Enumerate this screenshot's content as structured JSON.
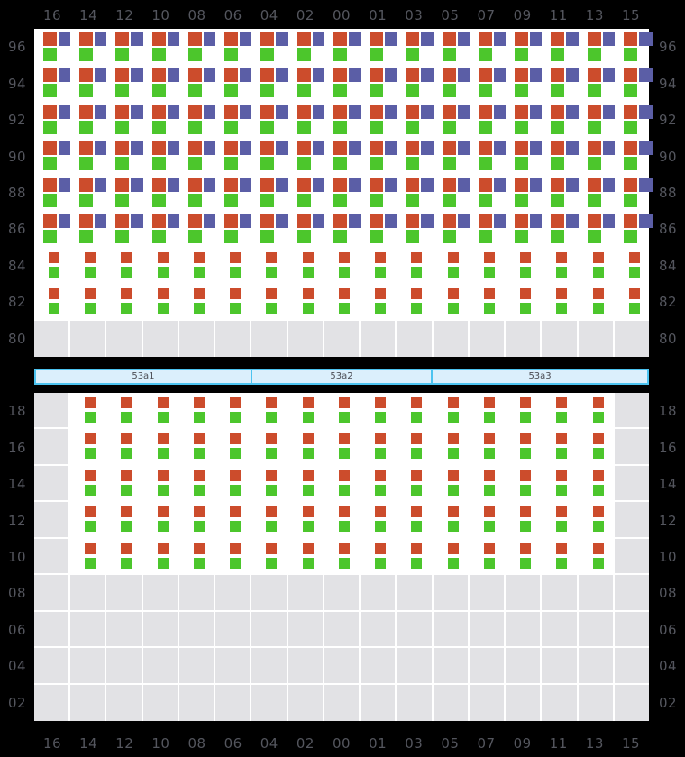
{
  "chart_data": {
    "type": "heatmap",
    "title": "",
    "xlabel": "",
    "ylabel": "",
    "grid": true,
    "legend": null,
    "x_tick_labels": [
      "16",
      "14",
      "12",
      "10",
      "08",
      "06",
      "04",
      "02",
      "00",
      "01",
      "03",
      "05",
      "07",
      "09",
      "11",
      "13",
      "15"
    ],
    "panels": [
      {
        "name": "top-panel",
        "y_tick_labels": [
          "96",
          "94",
          "92",
          "90",
          "88",
          "86",
          "84",
          "82",
          "80"
        ],
        "rows": [
          {
            "y": "96",
            "cells": [
              "abc",
              "abc",
              "abc",
              "abc",
              "abc",
              "abc",
              "abc",
              "abc",
              "abc",
              "abc",
              "abc",
              "abc",
              "abc",
              "abc",
              "abc",
              "abc",
              "abc"
            ]
          },
          {
            "y": "94",
            "cells": [
              "abc",
              "abc",
              "abc",
              "abc",
              "abc",
              "abc",
              "abc",
              "abc",
              "abc",
              "abc",
              "abc",
              "abc",
              "abc",
              "abc",
              "abc",
              "abc",
              "abc"
            ]
          },
          {
            "y": "92",
            "cells": [
              "abc",
              "abc",
              "abc",
              "abc",
              "abc",
              "abc",
              "abc",
              "abc",
              "abc",
              "abc",
              "abc",
              "abc",
              "abc",
              "abc",
              "abc",
              "abc",
              "abc"
            ]
          },
          {
            "y": "90",
            "cells": [
              "abc",
              "abc",
              "abc",
              "abc",
              "abc",
              "abc",
              "abc",
              "abc",
              "abc",
              "abc",
              "abc",
              "abc",
              "abc",
              "abc",
              "abc",
              "abc",
              "abc"
            ]
          },
          {
            "y": "88",
            "cells": [
              "abc",
              "abc",
              "abc",
              "abc",
              "abc",
              "abc",
              "abc",
              "abc",
              "abc",
              "abc",
              "abc",
              "abc",
              "abc",
              "abc",
              "abc",
              "abc",
              "abc"
            ]
          },
          {
            "y": "86",
            "cells": [
              "abc",
              "abc",
              "abc",
              "abc",
              "abc",
              "abc",
              "abc",
              "abc",
              "abc",
              "abc",
              "abc",
              "abc",
              "abc",
              "abc",
              "abc",
              "abc",
              "abc"
            ]
          },
          {
            "y": "84",
            "cells": [
              "ac",
              "ac",
              "ac",
              "ac",
              "ac",
              "ac",
              "ac",
              "ac",
              "ac",
              "ac",
              "ac",
              "ac",
              "ac",
              "ac",
              "ac",
              "ac",
              "ac"
            ]
          },
          {
            "y": "82",
            "cells": [
              "ac",
              "ac",
              "ac",
              "ac",
              "ac",
              "ac",
              "ac",
              "ac",
              "ac",
              "ac",
              "ac",
              "ac",
              "ac",
              "ac",
              "ac",
              "ac",
              "ac"
            ]
          },
          {
            "y": "80",
            "cells": [
              "",
              "",
              "",
              "",
              "",
              "",
              "",
              "",
              "",
              "",
              "",
              "",
              "",
              "",
              "",
              "",
              ""
            ]
          }
        ]
      },
      {
        "name": "bottom-panel",
        "y_tick_labels": [
          "18",
          "16",
          "14",
          "12",
          "10",
          "08",
          "06",
          "04",
          "02"
        ],
        "rows": [
          {
            "y": "18",
            "cells": [
              "",
              "ac",
              "ac",
              "ac",
              "ac",
              "ac",
              "ac",
              "ac",
              "ac",
              "ac",
              "ac",
              "ac",
              "ac",
              "ac",
              "ac",
              "ac",
              ""
            ]
          },
          {
            "y": "16",
            "cells": [
              "",
              "ac",
              "ac",
              "ac",
              "ac",
              "ac",
              "ac",
              "ac",
              "ac",
              "ac",
              "ac",
              "ac",
              "ac",
              "ac",
              "ac",
              "ac",
              ""
            ]
          },
          {
            "y": "14",
            "cells": [
              "",
              "ac",
              "ac",
              "ac",
              "ac",
              "ac",
              "ac",
              "ac",
              "ac",
              "ac",
              "ac",
              "ac",
              "ac",
              "ac",
              "ac",
              "ac",
              ""
            ]
          },
          {
            "y": "12",
            "cells": [
              "",
              "ac",
              "ac",
              "ac",
              "ac",
              "ac",
              "ac",
              "ac",
              "ac",
              "ac",
              "ac",
              "ac",
              "ac",
              "ac",
              "ac",
              "ac",
              ""
            ]
          },
          {
            "y": "10",
            "cells": [
              "",
              "ac",
              "ac",
              "ac",
              "ac",
              "ac",
              "ac",
              "ac",
              "ac",
              "ac",
              "ac",
              "ac",
              "ac",
              "ac",
              "ac",
              "ac",
              ""
            ]
          },
          {
            "y": "08",
            "cells": [
              "",
              "",
              "",
              "",
              "",
              "",
              "",
              "",
              "",
              "",
              "",
              "",
              "",
              "",
              "",
              "",
              ""
            ]
          },
          {
            "y": "06",
            "cells": [
              "",
              "",
              "",
              "",
              "",
              "",
              "",
              "",
              "",
              "",
              "",
              "",
              "",
              "",
              "",
              "",
              ""
            ]
          },
          {
            "y": "04",
            "cells": [
              "",
              "",
              "",
              "",
              "",
              "",
              "",
              "",
              "",
              "",
              "",
              "",
              "",
              "",
              "",
              "",
              ""
            ]
          },
          {
            "y": "02",
            "cells": [
              "",
              "",
              "",
              "",
              "",
              "",
              "",
              "",
              "",
              "",
              "",
              "",
              "",
              "",
              "",
              "",
              ""
            ]
          }
        ]
      }
    ],
    "marker_colors": {
      "a": "#cc4c2c",
      "b": "#5b5ea6",
      "c": "#4cc62c"
    }
  },
  "segment_bar": {
    "segments": [
      {
        "label": "53a1",
        "span": 6
      },
      {
        "label": "53a2",
        "span": 5
      },
      {
        "label": "53a3",
        "span": 6
      }
    ],
    "border_color": "#4cc3f0",
    "fill_color": "#dbeffc"
  },
  "colors": {
    "background": "#000000",
    "panel_background": "#ffffff",
    "empty_cell": "#e2e2e5",
    "gridline": "#ffffff",
    "tick_text": "#54565e"
  }
}
